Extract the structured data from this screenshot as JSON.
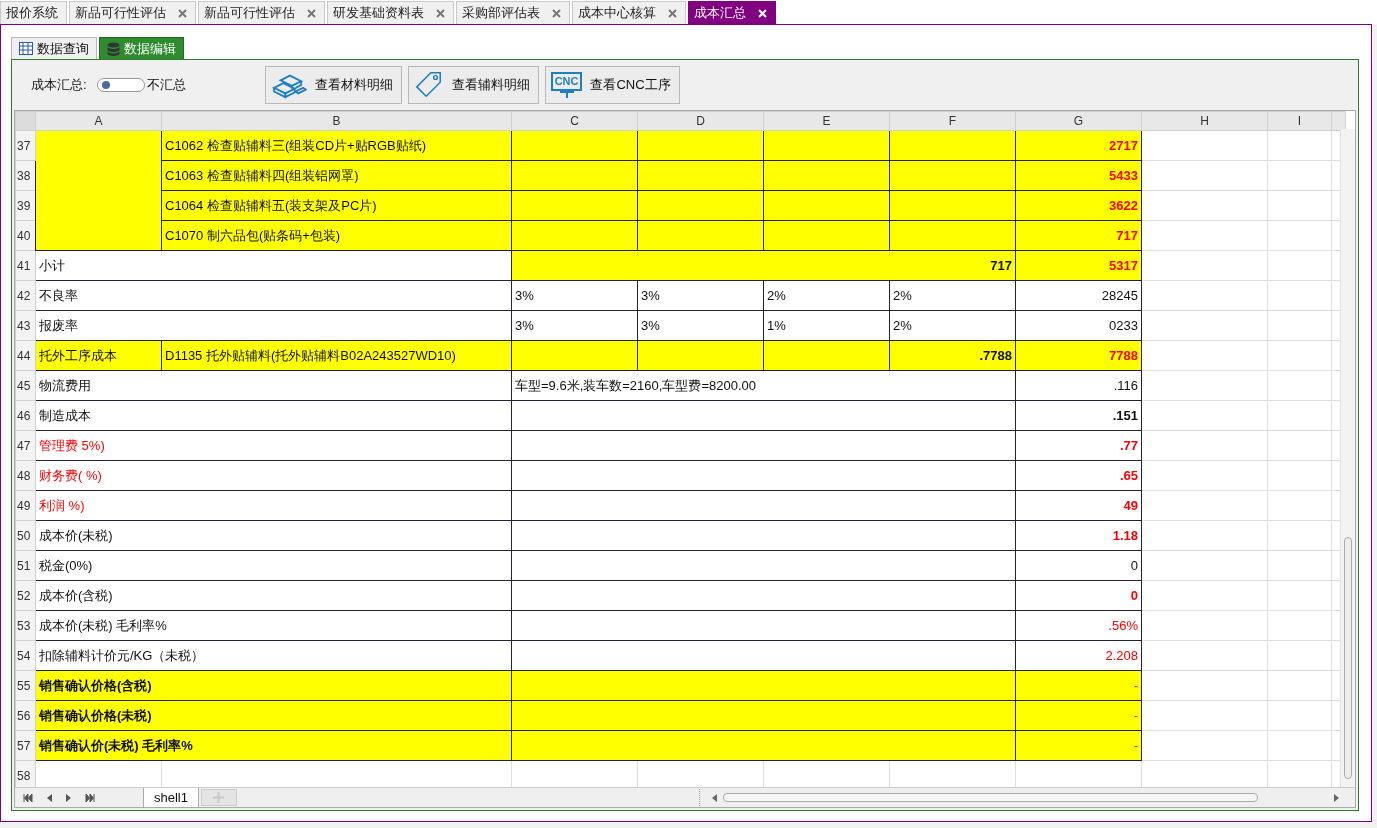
{
  "tabs": [
    {
      "label": "报价系统",
      "closable": false,
      "selected": false
    },
    {
      "label": "新品可行性评估",
      "closable": true,
      "selected": false
    },
    {
      "label": "新品可行性评估",
      "closable": true,
      "selected": false
    },
    {
      "label": "研发基础资料表",
      "closable": true,
      "selected": false
    },
    {
      "label": "采购部评估表",
      "closable": true,
      "selected": false
    },
    {
      "label": "成本中心核算",
      "closable": true,
      "selected": false
    },
    {
      "label": "成本汇总",
      "closable": true,
      "selected": true
    }
  ],
  "sub_tabs": [
    {
      "label": "数据查询",
      "kind": "grid",
      "selected": false
    },
    {
      "label": "数据编辑",
      "kind": "database",
      "selected": true
    }
  ],
  "toolbar": {
    "summary_label": "成本汇总:",
    "summary_on": false,
    "summary_text": "不汇总",
    "buttons": [
      {
        "label": "查看材料明细",
        "kind": "bars"
      },
      {
        "label": "查看辅料明细",
        "kind": "tag"
      },
      {
        "label": "查看CNC工序",
        "kind": "cnc",
        "icon_text": "CNC"
      }
    ]
  },
  "columns": [
    "A",
    "B",
    "C",
    "D",
    "E",
    "F",
    "G",
    "H",
    "I"
  ],
  "rows": [
    {
      "num": "37",
      "kind": "group-item",
      "b": "C1062 检查贴辅料三(组装CD片+贴RGB贴纸)",
      "g": "2717",
      "g_red": true,
      "g_bold": true
    },
    {
      "num": "38",
      "kind": "group-item",
      "b": "C1063 检查贴辅料四(组装铝网罩)",
      "g": "5433",
      "g_red": true,
      "g_bold": true
    },
    {
      "num": "39",
      "kind": "group-item",
      "b": "C1064 检查贴辅料五(装支架及PC片)",
      "g": "3622",
      "g_red": true,
      "g_bold": true
    },
    {
      "num": "40",
      "kind": "group-item",
      "b": "C1070 制六品包(贴条码+包装)",
      "g": "717",
      "g_red": true,
      "g_bold": true
    },
    {
      "num": "41",
      "kind": "subtotal",
      "label": "小计",
      "cf": "717",
      "g": "5317",
      "g_red": true,
      "g_bold": true
    },
    {
      "num": "42",
      "kind": "rate",
      "label": "不良率",
      "c": "3%",
      "d": "3%",
      "e": "2%",
      "f": "2%",
      "g": "28245",
      "g_red": false,
      "g_bold": false
    },
    {
      "num": "43",
      "kind": "rate",
      "label": "报废率",
      "c": "3%",
      "d": "3%",
      "e": "1%",
      "f": "2%",
      "g": "0233",
      "g_red": false,
      "g_bold": false
    },
    {
      "num": "44",
      "kind": "outsourced",
      "a": "托外工序成本",
      "b": "D1135 托外贴辅料(托外贴辅料B02A243527WD10)",
      "f": ".7788",
      "g": "7788",
      "g_red": true,
      "g_bold": true
    },
    {
      "num": "45",
      "kind": "note",
      "label": "物流费用",
      "cf": "车型=9.6米,装车数=2160,车型费=8200.00",
      "g": ".116",
      "g_red": false,
      "g_bold": false
    },
    {
      "num": "46",
      "kind": "total",
      "label": "制造成本",
      "label_red": false,
      "g": ".151",
      "g_red": false,
      "g_bold": true
    },
    {
      "num": "47",
      "kind": "total",
      "label": "管理费 5%)",
      "label_red": true,
      "g": ".77",
      "g_red": true,
      "g_bold": true
    },
    {
      "num": "48",
      "kind": "total",
      "label": "财务费( %)",
      "label_red": true,
      "g": ".65",
      "g_red": true,
      "g_bold": true
    },
    {
      "num": "49",
      "kind": "total",
      "label": "利润 %)",
      "label_red": true,
      "g": "49",
      "g_red": true,
      "g_bold": true
    },
    {
      "num": "50",
      "kind": "total",
      "label": "成本价(未税)",
      "label_red": false,
      "g": "1.18",
      "g_red": true,
      "g_bold": true
    },
    {
      "num": "51",
      "kind": "total",
      "label": "税金(0%)",
      "label_red": false,
      "g": "0",
      "g_red": false,
      "g_bold": false
    },
    {
      "num": "52",
      "kind": "total",
      "label": "成本价(含税)",
      "label_red": false,
      "g": "0",
      "g_red": true,
      "g_bold": true
    },
    {
      "num": "53",
      "kind": "total",
      "label": "成本价(未税) 毛利率%",
      "label_red": false,
      "g": ".56%",
      "g_red": true,
      "g_bold": false
    },
    {
      "num": "54",
      "kind": "total",
      "label": "扣除辅料计价元/KG（未税）",
      "label_red": false,
      "g": "2.208",
      "g_red": true,
      "g_bold": false
    },
    {
      "num": "55",
      "kind": "sale",
      "label": "销售确认价格(含税)",
      "g": "-"
    },
    {
      "num": "56",
      "kind": "sale",
      "label": "销售确认价格(未税)",
      "g": "-"
    },
    {
      "num": "57",
      "kind": "sale",
      "label": "销售确认价(未税) 毛利率%",
      "g": "-"
    },
    {
      "num": "58",
      "kind": "empty"
    }
  ],
  "sheets": [
    {
      "label": "shell1",
      "selected": true
    }
  ]
}
